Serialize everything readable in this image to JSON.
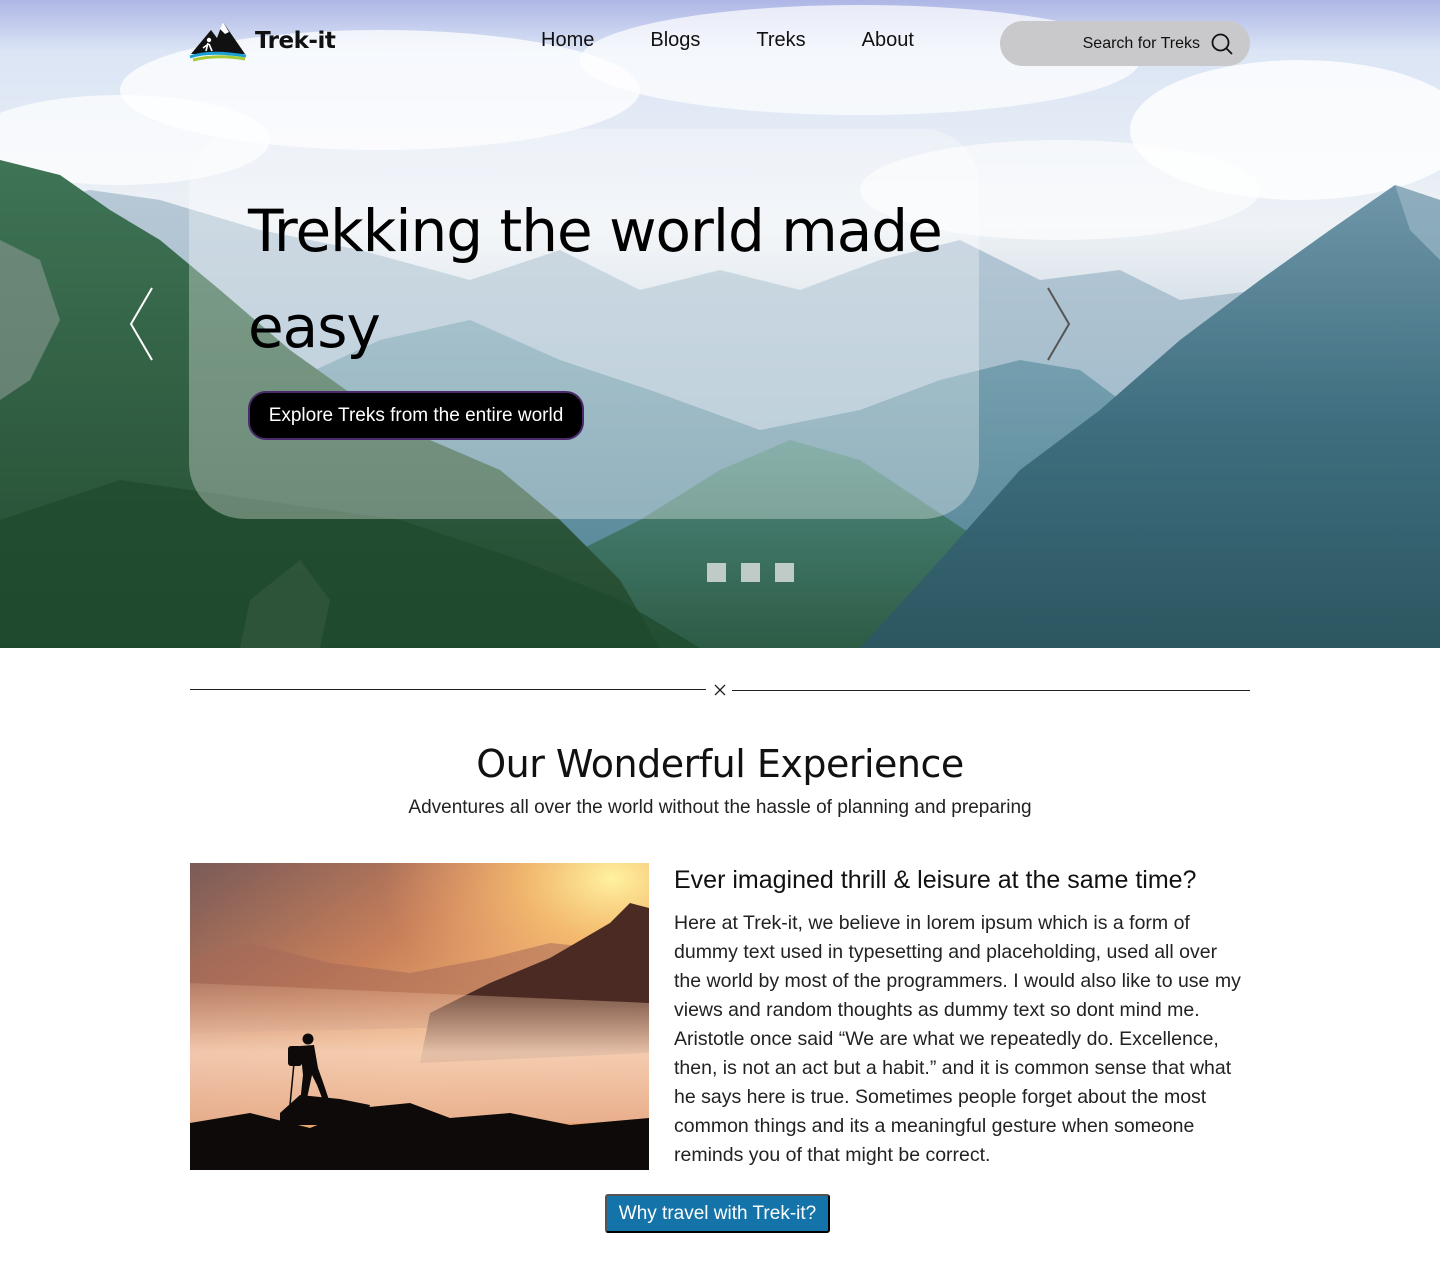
{
  "brand": {
    "name": "Trek-it",
    "logo_icon": "mountain-hiker-logo"
  },
  "nav": {
    "items": [
      {
        "label": "Home"
      },
      {
        "label": "Blogs"
      },
      {
        "label": "Treks"
      },
      {
        "label": "About"
      }
    ]
  },
  "search": {
    "label": "Search for Treks",
    "icon": "search-icon"
  },
  "hero": {
    "title": "Trekking the world made easy",
    "cta_label": "Explore Treks from the entire world",
    "prev_icon": "chevron-left-icon",
    "next_icon": "chevron-right-icon",
    "slide_count": 3
  },
  "section": {
    "divider_icon": "close-icon",
    "title": "Our Wonderful Experience",
    "subtitle": "Adventures all over the world without the hassle of planning and preparing"
  },
  "feature": {
    "heading": "Ever imagined thrill & leisure at the same time?",
    "body": "Here at Trek-it, we believe in lorem ipsum which is a form of dummy text used in typesetting and placeholding, used all over the world by most of the programmers. I would also like to use my views and random thoughts as dummy text so dont mind me. Aristotle once said “We are what we repeatedly do. Excellence, then, is not an act but a habit.” and it is common sense that what he says here is true. Sometimes people forget about the most common things and its a meaningful gesture when someone reminds you of that might be correct.",
    "button_label": "Why travel with Trek-it?"
  },
  "colors": {
    "accent": "#1473a8",
    "cta_bg": "#000000",
    "search_bg": "#c9c9cb"
  }
}
